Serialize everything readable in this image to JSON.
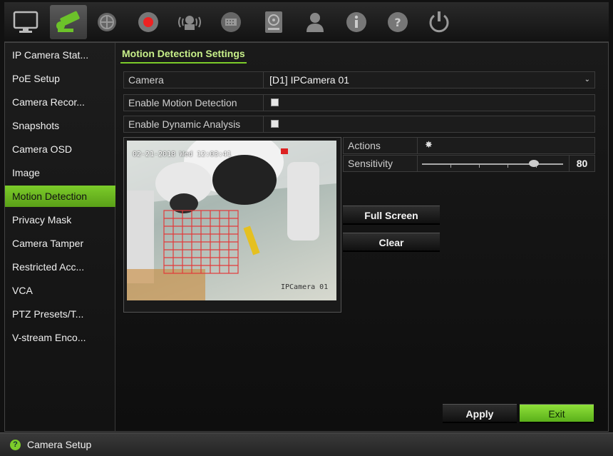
{
  "topbar": {
    "icons": [
      {
        "name": "display-icon"
      },
      {
        "name": "camera-icon"
      },
      {
        "name": "network-icon"
      },
      {
        "name": "record-icon"
      },
      {
        "name": "alarm-icon"
      },
      {
        "name": "device-icon"
      },
      {
        "name": "storage-icon"
      },
      {
        "name": "user-icon"
      },
      {
        "name": "info-icon"
      },
      {
        "name": "help-icon"
      },
      {
        "name": "power-icon"
      }
    ]
  },
  "sidebar": {
    "items": [
      {
        "label": "IP Camera Stat..."
      },
      {
        "label": "PoE Setup"
      },
      {
        "label": "Camera Recor..."
      },
      {
        "label": "Snapshots"
      },
      {
        "label": "Camera OSD"
      },
      {
        "label": "Image"
      },
      {
        "label": "Motion Detection",
        "selected": true
      },
      {
        "label": "Privacy Mask"
      },
      {
        "label": "Camera Tamper"
      },
      {
        "label": "Restricted Acc..."
      },
      {
        "label": "VCA"
      },
      {
        "label": "PTZ Presets/T..."
      },
      {
        "label": "V-stream Enco..."
      }
    ]
  },
  "main": {
    "title": "Motion Detection Settings",
    "camera_label": "Camera",
    "camera_value": "[D1] IPCamera 01",
    "enable_motion_label": "Enable Motion Detection",
    "enable_dynamic_label": "Enable Dynamic Analysis",
    "actions_label": "Actions",
    "sensitivity_label": "Sensitivity",
    "sensitivity_value": "80",
    "preview_timestamp": "02-21-2018 Wed 12:03:41",
    "preview_camera_name": "IPCamera 01",
    "full_screen_button": "Full Screen",
    "clear_button": "Clear",
    "apply_button": "Apply",
    "exit_button": "Exit"
  },
  "statusbar": {
    "text": "Camera Setup"
  },
  "colors": {
    "accent_green": "#7ccc2a",
    "grid_red": "#e23a3a"
  }
}
